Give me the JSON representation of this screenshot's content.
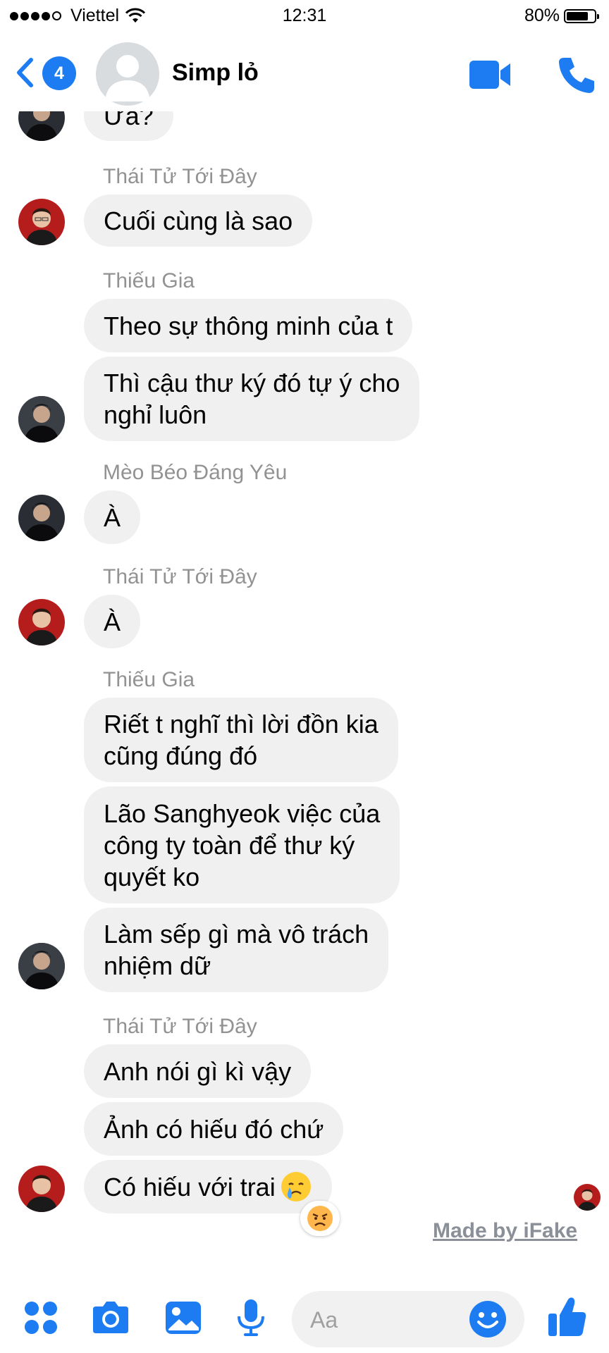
{
  "status_bar": {
    "carrier": "Viettel",
    "time": "12:31",
    "battery": "80%",
    "battery_level": 0.8
  },
  "header": {
    "back_count": "4",
    "title": "Simp lỏ"
  },
  "messages": {
    "partial_text": "Ừa?",
    "g1": {
      "sender": "Thái Tử Tới Đây",
      "bubble1": "Cuối cùng là sao"
    },
    "g2": {
      "sender": "Thiếu Gia",
      "bubble1": "Theo sự thông minh của t",
      "bubble2_line1": "Thì cậu thư ký đó tự ý cho",
      "bubble2_line2": "nghỉ luôn"
    },
    "g3": {
      "sender": "Mèo Béo Đáng Yêu",
      "bubble1": "À"
    },
    "g4": {
      "sender": "Thái Tử Tới Đây",
      "bubble1": "À"
    },
    "g5": {
      "sender": "Thiếu Gia",
      "bubble1_line1": "Riết t nghĩ thì lời đồn kia",
      "bubble1_line2": "cũng đúng đó",
      "bubble2_line1": "Lão Sanghyeok việc của",
      "bubble2_line2": "công ty toàn để thư ký",
      "bubble2_line3": "quyết  ko",
      "bubble3_line1": "Làm sếp gì mà vô trách",
      "bubble3_line2": "nhiệm dữ"
    },
    "g6": {
      "sender": "Thái Tử Tới Đây",
      "bubble1": "Anh nói gì kì vậy",
      "bubble2": "Ảnh có hiếu đó chứ",
      "bubble3": "Có hiếu với trai",
      "bubble3_emoji": "crying-face-emoji",
      "reaction": "angry-face-emoji"
    }
  },
  "watermark": "Made by iFake",
  "composer": {
    "placeholder": "Aa"
  },
  "icons": {
    "accent": "#1e7cf2",
    "bubble_bg": "#f0f0f0",
    "sender_name": "#929292"
  }
}
